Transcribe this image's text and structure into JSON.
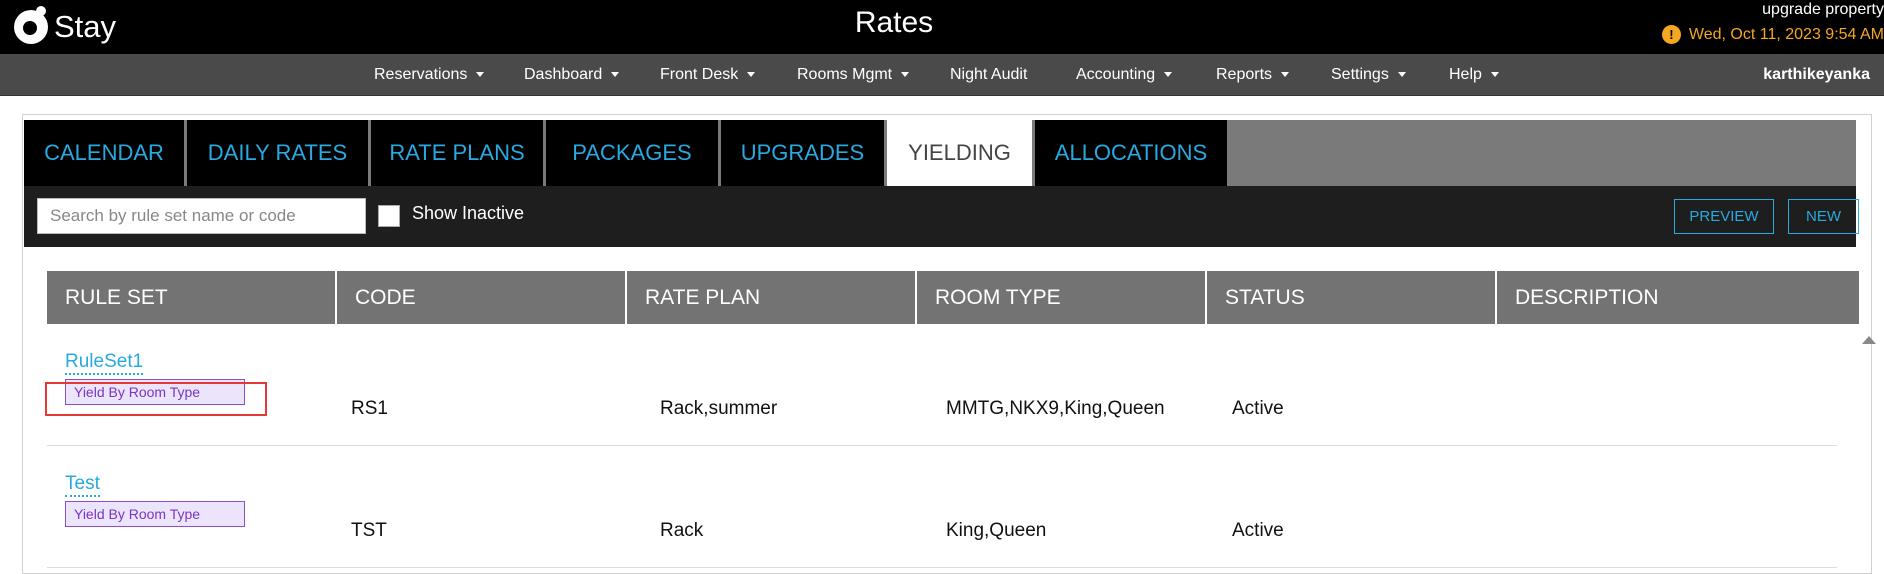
{
  "header": {
    "logo_text": "Stay",
    "title": "Rates",
    "upgrade_label": "upgrade property",
    "datetime": "Wed, Oct 11, 2023 9:54 AM",
    "warning_icon": "exclamation-circle-icon",
    "warning_color": "#f5a623"
  },
  "nav": {
    "items": [
      {
        "label": "Reservations"
      },
      {
        "label": "Dashboard"
      },
      {
        "label": "Front Desk"
      },
      {
        "label": "Rooms Mgmt"
      },
      {
        "label": "Night Audit"
      },
      {
        "label": "Accounting"
      },
      {
        "label": "Reports"
      },
      {
        "label": "Settings"
      },
      {
        "label": "Help"
      }
    ],
    "user": "karthikeyanka"
  },
  "tabs": [
    {
      "label": "CALENDAR"
    },
    {
      "label": "DAILY RATES"
    },
    {
      "label": "RATE PLANS"
    },
    {
      "label": "PACKAGES"
    },
    {
      "label": "UPGRADES"
    },
    {
      "label": "YIELDING",
      "active": true
    },
    {
      "label": "ALLOCATIONS"
    }
  ],
  "toolbar": {
    "search_placeholder": "Search by rule set name or code",
    "show_inactive_label": "Show Inactive",
    "show_inactive_checked": false,
    "preview_label": "PREVIEW",
    "new_label": "NEW"
  },
  "table": {
    "columns": [
      "RULE SET",
      "CODE",
      "RATE PLAN",
      "ROOM TYPE",
      "STATUS",
      "DESCRIPTION"
    ],
    "rows": [
      {
        "name": "RuleSet1",
        "badge": "Yield By Room Type",
        "code": "RS1",
        "rate_plan": "Rack,summer",
        "room_type": "MMTG,NKX9,King,Queen",
        "status": "Active",
        "description": ""
      },
      {
        "name": "Test",
        "badge": "Yield By Room Type",
        "code": "TST",
        "rate_plan": "Rack",
        "room_type": "King,Queen",
        "status": "Active",
        "description": ""
      }
    ]
  },
  "colors": {
    "accent": "#29a9e1",
    "badge_text": "#7a36c4",
    "badge_bg": "#ece4fa",
    "highlight": "#e53935"
  }
}
